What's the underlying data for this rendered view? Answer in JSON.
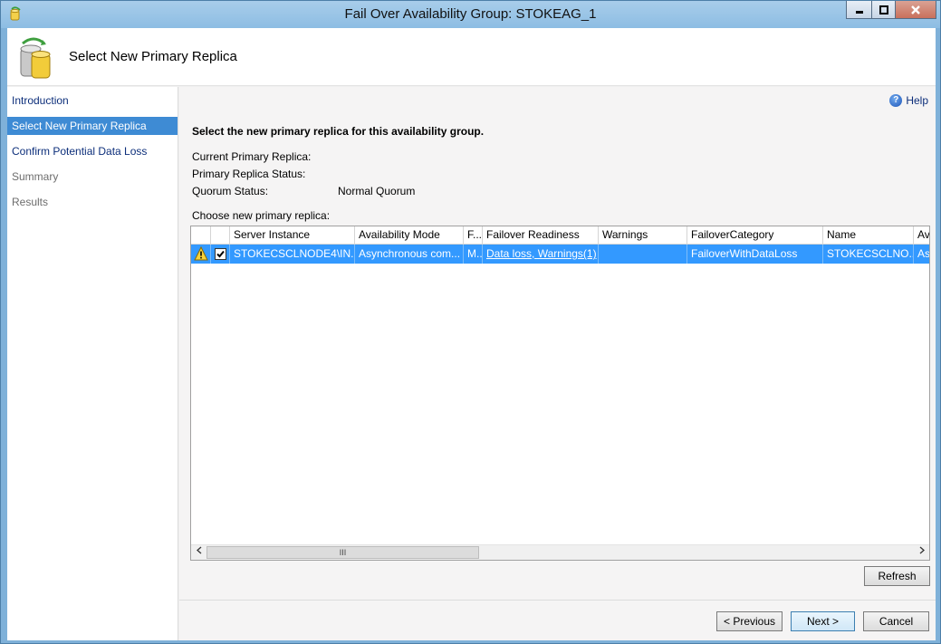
{
  "window": {
    "title": "Fail Over Availability Group: STOKEAG_1",
    "controls": {
      "minimize_icon": "minimize-icon",
      "maximize_icon": "maximize-icon",
      "close_icon": "close-icon"
    }
  },
  "header": {
    "title": "Select New Primary Replica"
  },
  "nav": {
    "items": [
      {
        "label": "Introduction",
        "state": "link"
      },
      {
        "label": "Select New Primary Replica",
        "state": "active"
      },
      {
        "label": "Confirm Potential Data Loss",
        "state": "link"
      },
      {
        "label": "Summary",
        "state": "disabled"
      },
      {
        "label": "Results",
        "state": "disabled"
      }
    ]
  },
  "main": {
    "help_label": "Help",
    "instruction": "Select the new primary replica for this availability group.",
    "current_primary_label": "Current Primary Replica:",
    "current_primary_value": "",
    "primary_status_label": "Primary Replica Status:",
    "primary_status_value": "",
    "quorum_label": "Quorum Status:",
    "quorum_value": "Normal Quorum",
    "choose_label": "Choose new primary replica:"
  },
  "grid": {
    "columns": [
      "",
      "",
      "Server Instance",
      "Availability Mode",
      "F...",
      "Failover Readiness",
      "Warnings",
      "FailoverCategory",
      "Name",
      "Av"
    ],
    "rows": [
      {
        "warning_icon": "warning-icon",
        "checked": true,
        "server_instance": "STOKECSCLNODE4\\IN...",
        "availability_mode": "Asynchronous com...",
        "failover_mode": "M...",
        "failover_readiness": "Data loss, Warnings(1)",
        "warnings": "",
        "failover_category": "FailoverWithDataLoss",
        "name": "STOKECSCLNO...",
        "av": "Asy"
      }
    ],
    "scroll_left_icon": "chevron-left-icon",
    "scroll_right_icon": "chevron-right-icon",
    "scroll_thumb_glyph": "III"
  },
  "buttons": {
    "refresh": "Refresh",
    "previous": "< Previous",
    "next": "Next >",
    "cancel": "Cancel"
  },
  "colors": {
    "selection": "#3399ff",
    "nav_active": "#3e8bd4",
    "link": "#0c2e7a"
  }
}
